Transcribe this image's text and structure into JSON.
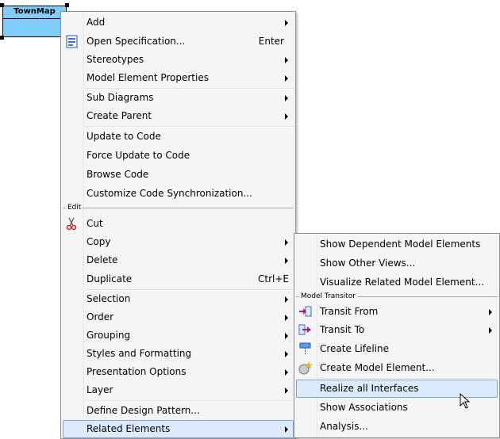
{
  "diagram": {
    "class_name": "TownMap"
  },
  "main_menu": {
    "items": [
      {
        "label": "Add",
        "submenu": true
      },
      {
        "label": "Open Specification...",
        "shortcut": "Enter",
        "icon": "specification-icon"
      },
      {
        "label": "Stereotypes",
        "submenu": true
      },
      {
        "label": "Model Element Properties",
        "submenu": true
      },
      {
        "label": "Sub Diagrams",
        "submenu": true
      },
      {
        "label": "Create Parent",
        "submenu": true
      },
      {
        "label": "Update to Code"
      },
      {
        "label": "Force Update to Code"
      },
      {
        "label": "Browse Code"
      },
      {
        "label": "Customize Code Synchronization..."
      },
      {
        "label": "Cut",
        "icon": "scissors-icon"
      },
      {
        "label": "Copy",
        "submenu": true
      },
      {
        "label": "Delete",
        "submenu": true
      },
      {
        "label": "Duplicate",
        "shortcut": "Ctrl+E"
      },
      {
        "label": "Selection",
        "submenu": true
      },
      {
        "label": "Order",
        "submenu": true
      },
      {
        "label": "Grouping",
        "submenu": true
      },
      {
        "label": "Styles and Formatting",
        "submenu": true
      },
      {
        "label": "Presentation Options",
        "submenu": true
      },
      {
        "label": "Layer",
        "submenu": true
      },
      {
        "label": "Define Design Pattern..."
      },
      {
        "label": "Related Elements",
        "submenu": true,
        "highlighted": true
      }
    ],
    "group_label_edit": "Edit"
  },
  "sub_menu": {
    "items": [
      {
        "label": "Show Dependent Model Elements"
      },
      {
        "label": "Show Other Views..."
      },
      {
        "label": "Visualize Related Model Element..."
      },
      {
        "label": "Transit From",
        "submenu": true,
        "icon": "transit-from-icon"
      },
      {
        "label": "Transit To",
        "submenu": true,
        "icon": "transit-to-icon"
      },
      {
        "label": "Create Lifeline",
        "icon": "lifeline-icon"
      },
      {
        "label": "Create Model Element...",
        "icon": "model-element-icon"
      },
      {
        "label": "Realize all Interfaces",
        "highlighted": true
      },
      {
        "label": "Show Associations"
      },
      {
        "label": "Analysis..."
      }
    ],
    "group_label_transitor": "Model Transitor"
  },
  "colors": {
    "class_fill": "#7fcdf8",
    "highlight_fill": "#dcebfc",
    "highlight_border": "#7da2ce"
  }
}
